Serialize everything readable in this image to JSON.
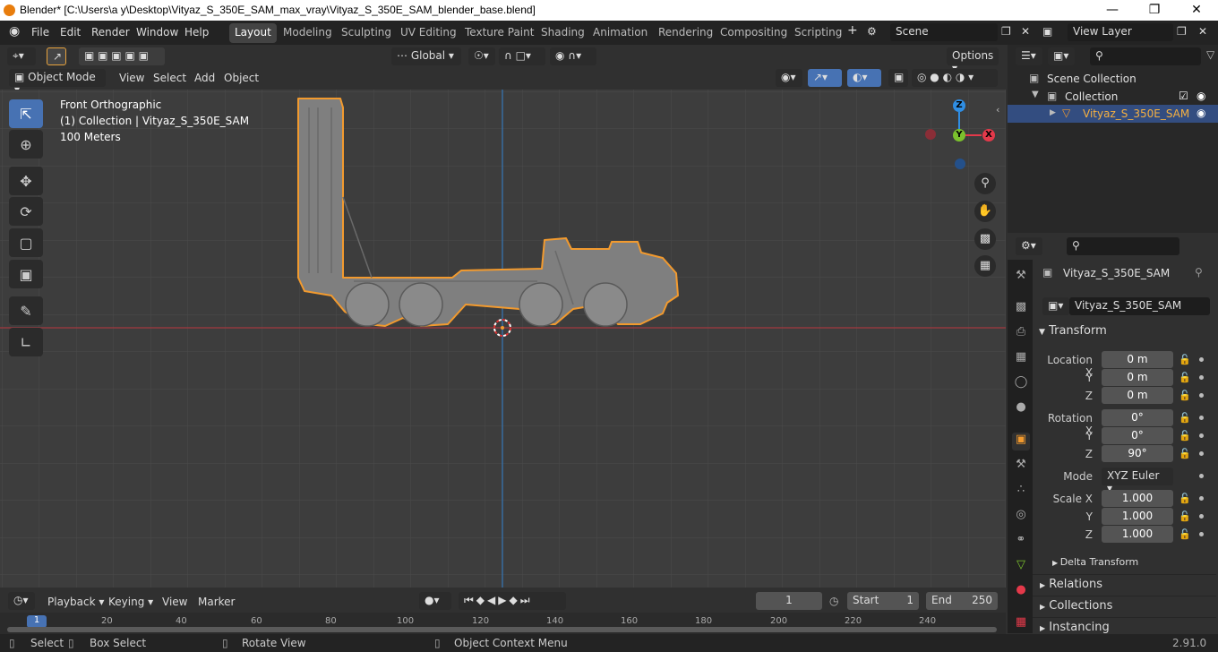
{
  "window": {
    "title": "Blender* [C:\\Users\\a y\\Desktop\\Vityaz_S_350E_SAM_max_vray\\Vityaz_S_350E_SAM_blender_base.blend]"
  },
  "menu": [
    "File",
    "Edit",
    "Render",
    "Window",
    "Help"
  ],
  "workspaces": [
    "Layout",
    "Modeling",
    "Sculpting",
    "UV Editing",
    "Texture Paint",
    "Shading",
    "Animation",
    "Rendering",
    "Compositing",
    "Scripting"
  ],
  "scene": {
    "name": "Scene",
    "view_layer": "View Layer"
  },
  "header": {
    "transform_orientation": "Global",
    "options": "Options"
  },
  "viewport_header": {
    "mode": "Object Mode",
    "menus": [
      "View",
      "Select",
      "Add",
      "Object"
    ]
  },
  "overlay": {
    "view_name": "Front Orthographic",
    "collection": "(1) Collection | Vityaz_S_350E_SAM",
    "scale": "100 Meters"
  },
  "gizmo": {
    "z": "Z",
    "y": "Y",
    "x": "X"
  },
  "outliner": {
    "root": "Scene Collection",
    "collection": "Collection",
    "object": "Vityaz_S_350E_SAM"
  },
  "properties": {
    "object_name": "Vityaz_S_350E_SAM",
    "data_name": "Vityaz_S_350E_SAM",
    "transform_title": "Transform",
    "location": {
      "label": "Location X",
      "x": "0 m",
      "y": "0 m",
      "z": "0 m"
    },
    "rotation": {
      "label": "Rotation X",
      "x": "0°",
      "y": "0°",
      "z": "90°"
    },
    "mode_label": "Mode",
    "mode_value": "XYZ Euler",
    "scale": {
      "label": "Scale X",
      "x": "1.000",
      "y": "1.000",
      "z": "1.000"
    },
    "axis_y": "Y",
    "axis_z": "Z",
    "delta": "Delta Transform",
    "sections": [
      "Relations",
      "Collections",
      "Instancing"
    ]
  },
  "timeline": {
    "menus": [
      "Playback",
      "Keying",
      "View",
      "Marker"
    ],
    "current_frame": "1",
    "start_label": "Start",
    "start": "1",
    "end_label": "End",
    "end": "250",
    "ticks": [
      "1",
      "20",
      "40",
      "60",
      "80",
      "100",
      "120",
      "140",
      "160",
      "180",
      "200",
      "220",
      "240"
    ]
  },
  "status": {
    "select": "Select",
    "box_select": "Box Select",
    "rotate": "Rotate View",
    "context": "Object Context Menu",
    "version": "2.91.0"
  },
  "colors": {
    "accent": "#4772b3",
    "selection": "#f5a623",
    "x_axis": "#e4394a",
    "y_axis": "#7bc12d",
    "z_axis": "#2f8ee4"
  }
}
